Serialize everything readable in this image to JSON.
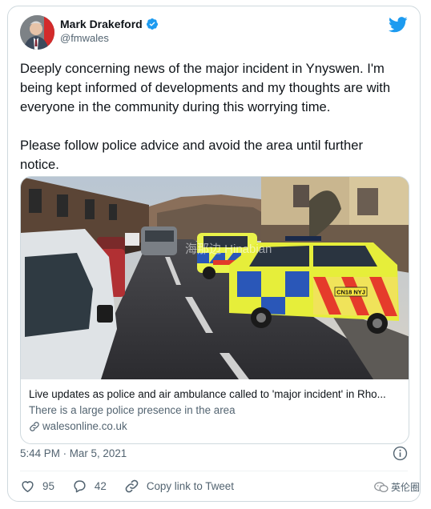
{
  "author": {
    "display_name": "Mark Drakeford",
    "handle": "@fmwales",
    "verified": true
  },
  "tweet": {
    "paragraphs": [
      "Deeply concerning news of the major incident in Ynyswen. I'm being kept informed of developments and my thoughts are with everyone in the community during this worrying time.",
      "Please follow police advice and avoid the area until further notice."
    ]
  },
  "link_card": {
    "title": "Live updates as police and air ambulance called to 'major incident' in Rho...",
    "description": "There is a large police presence in the area",
    "domain": "walesonline.co.uk",
    "image_watermark": "海那边 Hinabian",
    "plate": "CN18 NYJ"
  },
  "timestamp": "5:44 PM · Mar 5, 2021",
  "actions": {
    "like_count": "95",
    "reply_count": "42",
    "copy_link_label": "Copy link to Tweet"
  },
  "watermark": "英伦圈",
  "colors": {
    "twitter_blue": "#1d9bf0",
    "text_primary": "#0f1419",
    "text_secondary": "#536471",
    "border": "#cfd9de"
  }
}
